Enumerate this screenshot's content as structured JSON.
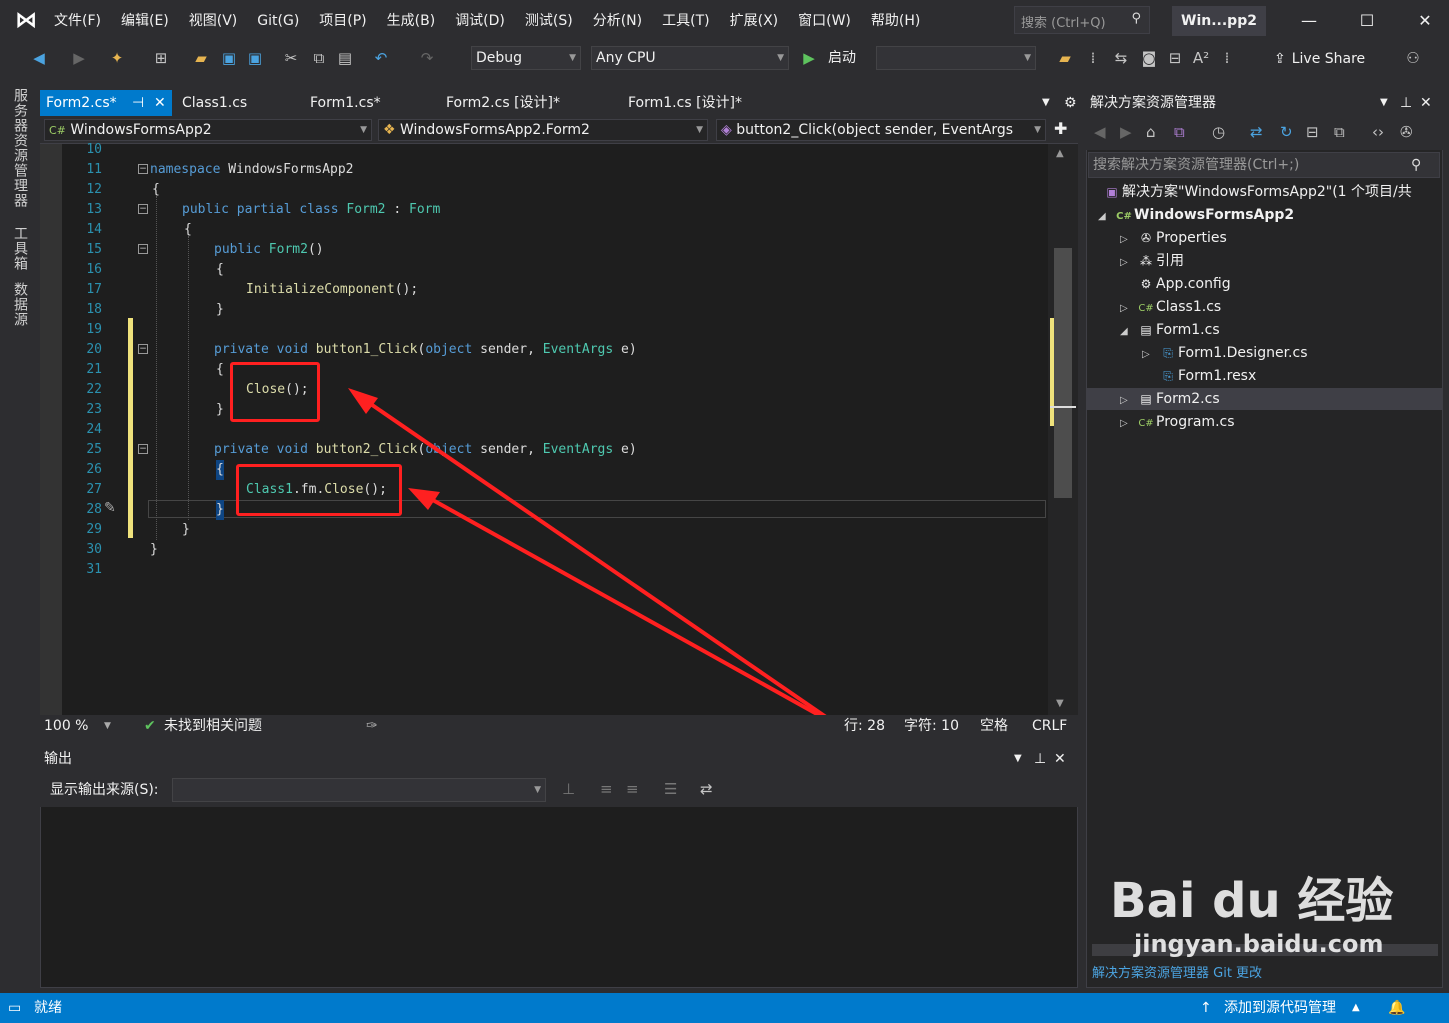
{
  "menubar": {
    "items": [
      "文件(F)",
      "编辑(E)",
      "视图(V)",
      "Git(G)",
      "项目(P)",
      "生成(B)",
      "调试(D)",
      "测试(S)",
      "分析(N)",
      "工具(T)",
      "扩展(X)",
      "窗口(W)",
      "帮助(H)"
    ],
    "search_placeholder": "搜索 (Ctrl+Q)",
    "window_title": "Win...pp2"
  },
  "toolbar": {
    "config": "Debug",
    "platform": "Any CPU",
    "start_label": "启动",
    "live_share": "Live Share"
  },
  "left_tabs": [
    "服务器资源管理器",
    "工具箱",
    "数据源"
  ],
  "editor": {
    "tabs": [
      "Form2.cs*",
      "Class1.cs",
      "Form1.cs*",
      "Form2.cs [设计]*",
      "Form1.cs [设计]*"
    ],
    "nav_project": "WindowsFormsApp2",
    "nav_class": "WindowsFormsApp2.Form2",
    "nav_member": "button2_Click(object sender, EventArgs",
    "line_numbers": [
      "10",
      "11",
      "12",
      "13",
      "14",
      "15",
      "16",
      "17",
      "18",
      "19",
      "20",
      "21",
      "22",
      "23",
      "24",
      "25",
      "26",
      "27",
      "28",
      "29",
      "30",
      "31"
    ],
    "code": {
      "l11_kw": "namespace",
      "l11_name": " WindowsFormsApp2",
      "l12": "{",
      "l13_kw": "public partial class",
      "l13_name": " Form2",
      "l13_sep": " : ",
      "l13_base": "Form",
      "l14": "{",
      "l15_kw": "public",
      "l15_name": " Form2",
      "l15_rest": "()",
      "l16": "{",
      "l17_m": "InitializeComponent",
      "l17_rest": "();",
      "l18": "}",
      "l20_kw": "private void",
      "l20_m": " button1_Click",
      "l20_p1": "(",
      "l20_kw2": "object",
      "l20_p2": " sender, ",
      "l20_ty": "EventArgs",
      "l20_p3": " e)",
      "l21": "{",
      "l22_m": "Close",
      "l22_rest": "();",
      "l23": "}",
      "l25_kw": "private void",
      "l25_m": " button2_Click",
      "l25_p1": "(",
      "l25_kw2": "object",
      "l25_p2": " sender, ",
      "l25_ty": "EventArgs",
      "l25_p3": " e)",
      "l26": "{",
      "l27_ty": "Class1",
      "l27_p": ".fm.",
      "l27_m": "Close",
      "l27_rest": "();",
      "l28": "}",
      "l29": "}",
      "l30": "}"
    },
    "zoom": "100 %",
    "issues": "未找到相关问题",
    "line": "行: 28",
    "char": "字符: 10",
    "spaces": "空格",
    "eol": "CRLF"
  },
  "output": {
    "title": "输出",
    "source_label": "显示输出来源(S):",
    "source_value": ""
  },
  "solution_explorer": {
    "title": "解决方案资源管理器",
    "search_placeholder": "搜索解决方案资源管理器(Ctrl+;)",
    "items": [
      {
        "label": "解决方案\"WindowsFormsApp2\"(1 个项目/共",
        "icon": "solution-icon"
      },
      {
        "label": "WindowsFormsApp2",
        "icon": "csproj-icon"
      },
      {
        "label": "Properties",
        "icon": "wrench-icon"
      },
      {
        "label": "引用",
        "icon": "references-icon"
      },
      {
        "label": "App.config",
        "icon": "config-icon"
      },
      {
        "label": "Class1.cs",
        "icon": "csharp-icon"
      },
      {
        "label": "Form1.cs",
        "icon": "form-icon"
      },
      {
        "label": "Form1.Designer.cs",
        "icon": "designer-icon"
      },
      {
        "label": "Form1.resx",
        "icon": "resx-icon"
      },
      {
        "label": "Form2.cs",
        "icon": "form-icon"
      },
      {
        "label": "Program.cs",
        "icon": "csharp-icon"
      }
    ],
    "bottom_tab": "解决方案资源管理器  Git 更改"
  },
  "status": {
    "ready": "就绪",
    "source_control": "添加到源代码管理"
  },
  "watermark": {
    "brand": "Bai du 经验",
    "url": "jingyan.baidu.com"
  },
  "annotation_color": "#ff2020"
}
